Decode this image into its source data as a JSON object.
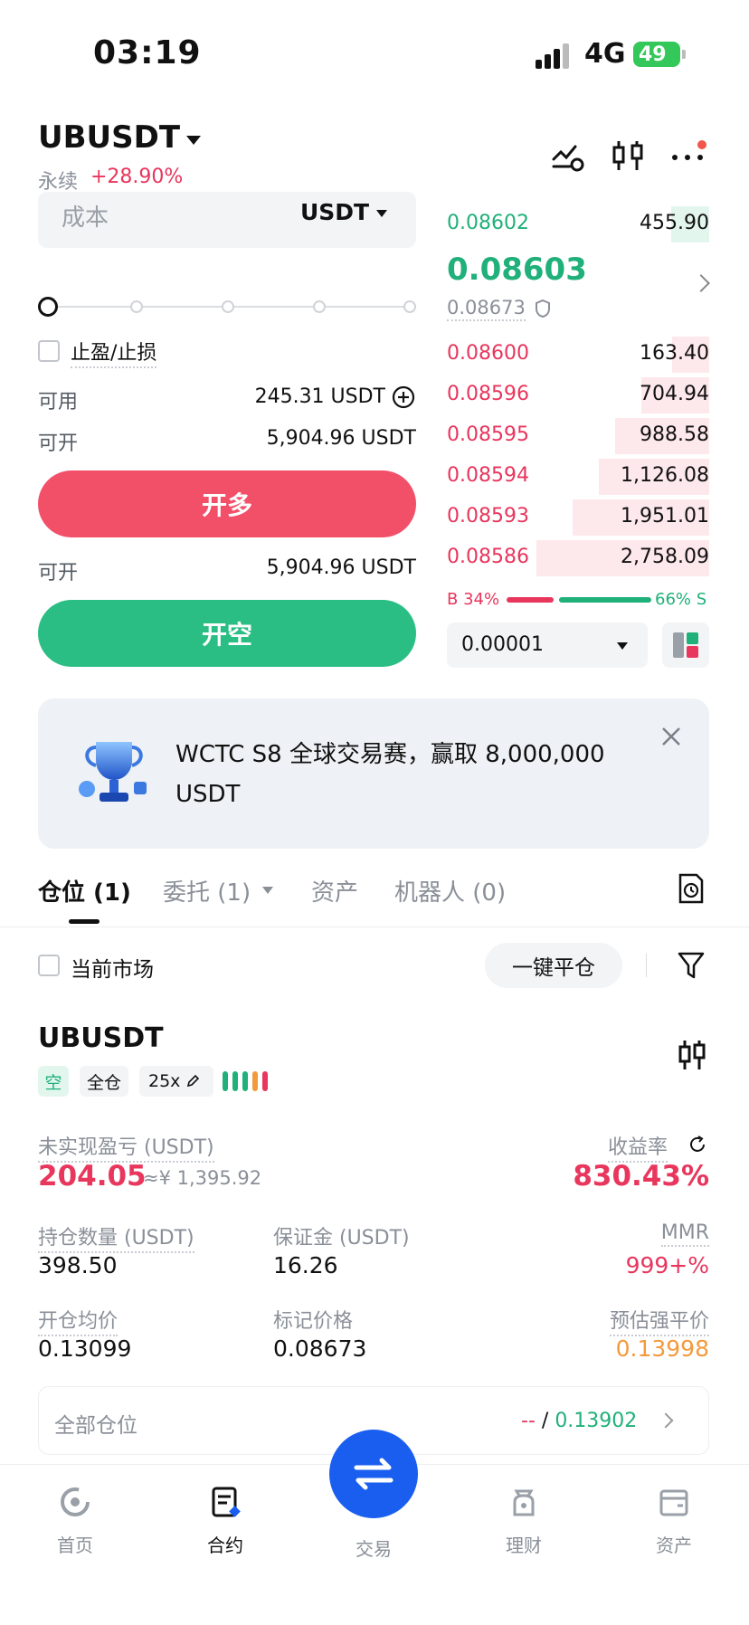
{
  "status_bar": {
    "time": "03:19",
    "network": "4G",
    "battery": "49"
  },
  "header": {
    "pair": "UBUSDT",
    "perp_label": "永续",
    "change": "+28.90%"
  },
  "order_form": {
    "cost_label": "成本",
    "cost_unit": "USDT",
    "tpsl_label": "止盈/止损",
    "available_label": "可用",
    "available_value": "245.31 USDT",
    "open_label_1": "可开",
    "open_value_1": "5,904.96 USDT",
    "long_button": "开多",
    "open_label_2": "可开",
    "open_value_2": "5,904.96 USDT",
    "short_button": "开空"
  },
  "order_book": {
    "top_bid": {
      "price": "0.08602",
      "qty": "455.90"
    },
    "last_price": "0.08603",
    "mark_price": "0.08673",
    "asks": [
      {
        "price": "0.08600",
        "qty": "163.40",
        "depth": 0.14
      },
      {
        "price": "0.08596",
        "qty": "704.94",
        "depth": 0.26
      },
      {
        "price": "0.08595",
        "qty": "988.58",
        "depth": 0.36
      },
      {
        "price": "0.08594",
        "qty": "1,126.08",
        "depth": 0.42
      },
      {
        "price": "0.08593",
        "qty": "1,951.01",
        "depth": 0.52
      },
      {
        "price": "0.08586",
        "qty": "2,758.09",
        "depth": 0.66
      }
    ],
    "buy_ratio": "B 34%",
    "sell_ratio": "66% S",
    "buy_fraction": 0.34,
    "precision": "0.00001"
  },
  "banner": {
    "text": "WCTC S8 全球交易赛，赢取 8,000,000 USDT"
  },
  "tabs": {
    "positions": "仓位 (1)",
    "orders": "委托 (1)",
    "assets": "资产",
    "bots": "机器人 (0)"
  },
  "filters": {
    "current_market": "当前市场",
    "close_all": "一键平仓"
  },
  "position": {
    "symbol": "UBUSDT",
    "side_tag": "空",
    "margin_mode": "全仓",
    "leverage": "25x",
    "unrealized_pnl_label": "未实现盈亏 (USDT)",
    "unrealized_pnl": "204.05",
    "unrealized_pnl_cny": "≈¥ 1,395.92",
    "roe_label": "收益率",
    "roe": "830.43%",
    "size_label": "持仓数量 (USDT)",
    "size": "398.50",
    "margin_label": "保证金 (USDT)",
    "margin": "16.26",
    "mmr_label": "MMR",
    "mmr": "999+%",
    "entry_label": "开仓均价",
    "entry": "0.13099",
    "mark_label": "标记价格",
    "mark": "0.08673",
    "liq_label": "预估强平价",
    "liq": "0.13998"
  },
  "all_positions": {
    "label": "全部仓位",
    "dash": "--",
    "sep": "/",
    "value": "0.13902"
  },
  "bottom_nav": {
    "home": "首页",
    "futures": "合约",
    "trade": "交易",
    "earn": "理财",
    "assets": "资产"
  },
  "colors": {
    "green": "#20b07a",
    "red": "#e8365d",
    "orange": "#f39a3d",
    "brand_blue": "#1a5ef0"
  }
}
